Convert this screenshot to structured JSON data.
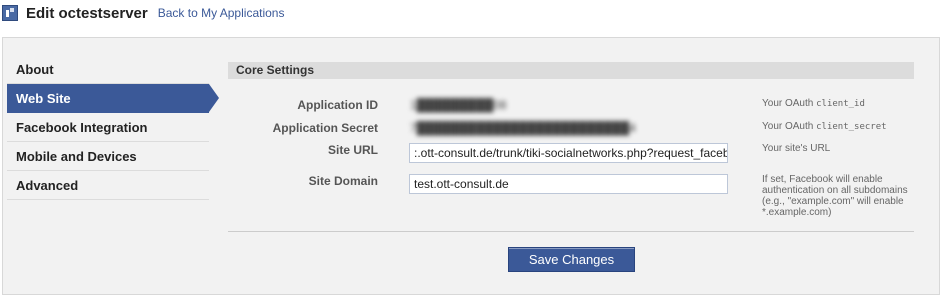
{
  "header": {
    "title": "Edit octestserver",
    "back_link": "Back to My Applications"
  },
  "sidebar": {
    "items": [
      {
        "label": "About",
        "active": false
      },
      {
        "label": "Web Site",
        "active": true
      },
      {
        "label": "Facebook Integration",
        "active": false
      },
      {
        "label": "Mobile and Devices",
        "active": false
      },
      {
        "label": "Advanced",
        "active": false
      }
    ]
  },
  "main": {
    "section_title": "Core Settings",
    "fields": {
      "app_id": {
        "label": "Application ID",
        "value": "1█████████08",
        "help_prefix": "Your OAuth ",
        "help_code": "client_id"
      },
      "app_secret": {
        "label": "Application Secret",
        "value": "7█████████████████████████4",
        "help_prefix": "Your OAuth ",
        "help_code": "client_secret"
      },
      "site_url": {
        "label": "Site URL",
        "value": ":.ott-consult.de/trunk/tiki-socialnetworks.php?request_facebook",
        "help": "Your site's URL"
      },
      "site_domain": {
        "label": "Site Domain",
        "value": "test.ott-consult.de",
        "help": "If set, Facebook will enable authentication on all subdomains (e.g., \"example.com\" will enable *.example.com)"
      }
    },
    "save_label": "Save Changes"
  },
  "colors": {
    "accent": "#3b5998",
    "panel_bg": "#f2f2f2",
    "section_bg": "#dcdcdc"
  }
}
